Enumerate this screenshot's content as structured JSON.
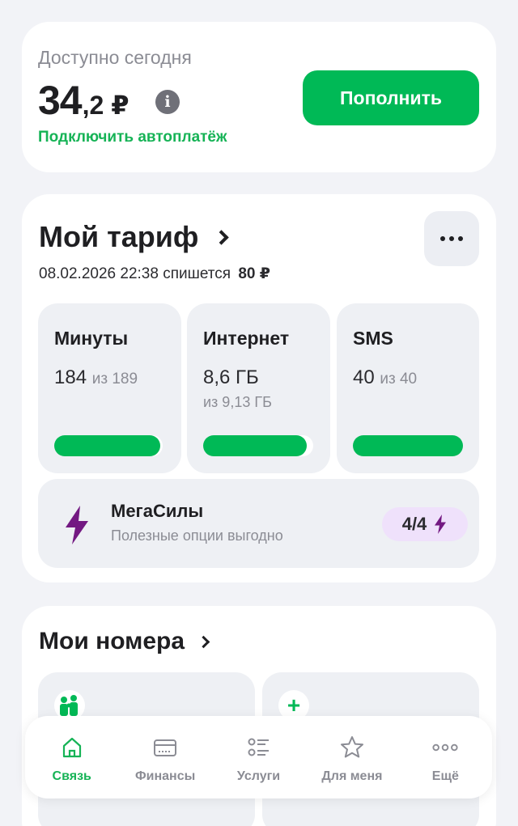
{
  "balance": {
    "label": "Доступно сегодня",
    "amount_int": "34",
    "amount_frac": ",2 ₽",
    "info_glyph": "i",
    "autopay_link": "Подключить автоплатёж",
    "topup_button": "Пополнить"
  },
  "tariff": {
    "title": "Мой тариф",
    "charge_date": "08.02.2026 22:38 спишется",
    "charge_amount": "80 ₽",
    "quotas": [
      {
        "title": "Минуты",
        "value": "184",
        "of": "из 189",
        "sub": "",
        "fill": 0.974
      },
      {
        "title": "Интернет",
        "value": "8,6 ГБ",
        "of": "",
        "sub": "из 9,13 ГБ",
        "fill": 0.942
      },
      {
        "title": "SMS",
        "value": "40",
        "of": "из 40",
        "sub": "",
        "fill": 1.0
      }
    ],
    "megasily": {
      "title": "МегаСилы",
      "subtitle": "Полезные опции выгодно",
      "badge": "4/4",
      "icon": "bolt-icon"
    }
  },
  "numbers": {
    "title": "Мои номера",
    "tiles": [
      {
        "icon": "family-icon"
      },
      {
        "icon": "plus-icon",
        "glyph": "+"
      }
    ]
  },
  "nav": {
    "items": [
      {
        "label": "Связь",
        "icon": "home-icon",
        "active": true
      },
      {
        "label": "Финансы",
        "icon": "wallet-icon",
        "active": false
      },
      {
        "label": "Услуги",
        "icon": "list-icon",
        "active": false
      },
      {
        "label": "Для меня",
        "icon": "star-icon",
        "active": false
      },
      {
        "label": "Ещё",
        "icon": "more-dots-icon",
        "active": false
      }
    ]
  },
  "colors": {
    "accent_green": "#00b956",
    "link_green": "#16b356",
    "purple": "#731982",
    "badge_bg": "#efe1fb",
    "background": "#f2f3f7"
  }
}
